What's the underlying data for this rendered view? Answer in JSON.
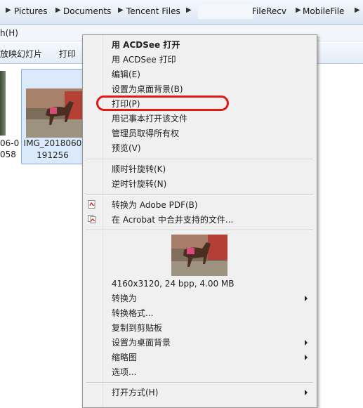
{
  "address_bar": {
    "segments": [
      "Pictures",
      "Documents",
      "Tencent Files",
      "FileRecv",
      "MobileFile"
    ]
  },
  "menubar": {
    "help_fragment": "h(H)"
  },
  "toolbar": {
    "slideshow_fragment": "放映幻灯片",
    "print": "打印"
  },
  "left_item": {
    "caption_1": "06-0",
    "caption_2": "058"
  },
  "selected_file": {
    "name": "IMG_2018060",
    "name_2": "191256"
  },
  "context_menu": {
    "items": [
      {
        "label": "用 ACDSee 打开",
        "bold": true
      },
      {
        "label": "用 ACDSee 打印"
      },
      {
        "label": "编辑(E)"
      },
      {
        "label": "设置为桌面背景(B)"
      },
      {
        "label": "打印(P)"
      },
      {
        "label": "用记事本打开该文件"
      },
      {
        "label": "管理员取得所有权"
      },
      {
        "label": "预览(V)"
      },
      {
        "label": "顺时针旋转(K)"
      },
      {
        "label": "逆时针旋转(N)"
      },
      {
        "label": "转换为 Adobe PDF(B)"
      },
      {
        "label": "在 Acrobat 中合并支持的文件..."
      },
      {
        "label": "4160x3120, 24 bpp, 4.00 MB"
      },
      {
        "label": "转换为",
        "submenu": true
      },
      {
        "label": "转换格式..."
      },
      {
        "label": "复制到剪贴板"
      },
      {
        "label": "设置为桌面背景",
        "submenu": true
      },
      {
        "label": "缩略图",
        "submenu": true
      },
      {
        "label": "选项..."
      },
      {
        "label": "打开方式(H)",
        "submenu": true
      }
    ]
  },
  "colors": {
    "highlight": "#e01919",
    "selection": "#dbeafb"
  },
  "icons": [
    "pdf-convert-icon",
    "acrobat-combine-icon",
    "submenu-arrow-icon"
  ]
}
